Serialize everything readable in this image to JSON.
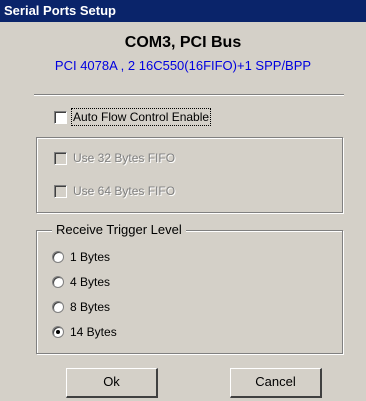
{
  "window": {
    "title": "Serial Ports Setup"
  },
  "port": {
    "name": "COM3, PCI Bus",
    "details": "PCI 4078A , 2 16C550(16FIFO)+1 SPP/BPP"
  },
  "options": {
    "auto_flow": {
      "label": "Auto Flow Control Enable",
      "checked": false
    },
    "fifo32": {
      "label": "Use 32 Bytes FIFO",
      "checked": false,
      "enabled": false
    },
    "fifo64": {
      "label": "Use 64 Bytes FIFO",
      "checked": false,
      "enabled": false
    }
  },
  "trigger": {
    "caption": "Receive Trigger Level",
    "selected": "14 Bytes",
    "levels": [
      "1 Bytes",
      "4 Bytes",
      "8 Bytes",
      "14 Bytes"
    ]
  },
  "buttons": {
    "ok": "Ok",
    "cancel": "Cancel"
  }
}
